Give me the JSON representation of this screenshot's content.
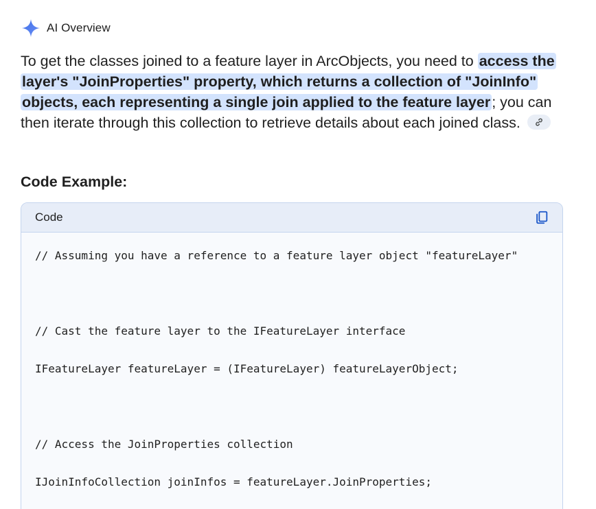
{
  "header": {
    "label": "AI Overview",
    "icon": "sparkle-icon",
    "icon_color": "#4a7bf0"
  },
  "paragraph": {
    "intro": "To get the classes joined to a feature layer in ArcObjects, you need to ",
    "highlight": "access the layer's \"JoinProperties\" property, which returns a collection of \"JoinInfo\" objects, each representing a single join applied to the feature layer",
    "rest": "; you can then iterate through this collection to retrieve details about each joined class. ",
    "link_icon": "link-icon"
  },
  "section": {
    "title": "Code Example:"
  },
  "code": {
    "label": "Code",
    "copy_icon": "copy-icon",
    "lines": [
      "// Assuming you have a reference to a feature layer object \"featureLayer\"",
      "// Cast the feature layer to the IFeatureLayer interface",
      "IFeatureLayer featureLayer = (IFeatureLayer) featureLayerObject;",
      "// Access the JoinProperties collection",
      "IJoinInfoCollection joinInfos = featureLayer.JoinProperties;"
    ]
  },
  "colors": {
    "highlight_bg": "#d3e3fd",
    "code_header_bg": "#e7edf8",
    "code_border": "#c4d4ee",
    "accent": "#1a56c9"
  }
}
